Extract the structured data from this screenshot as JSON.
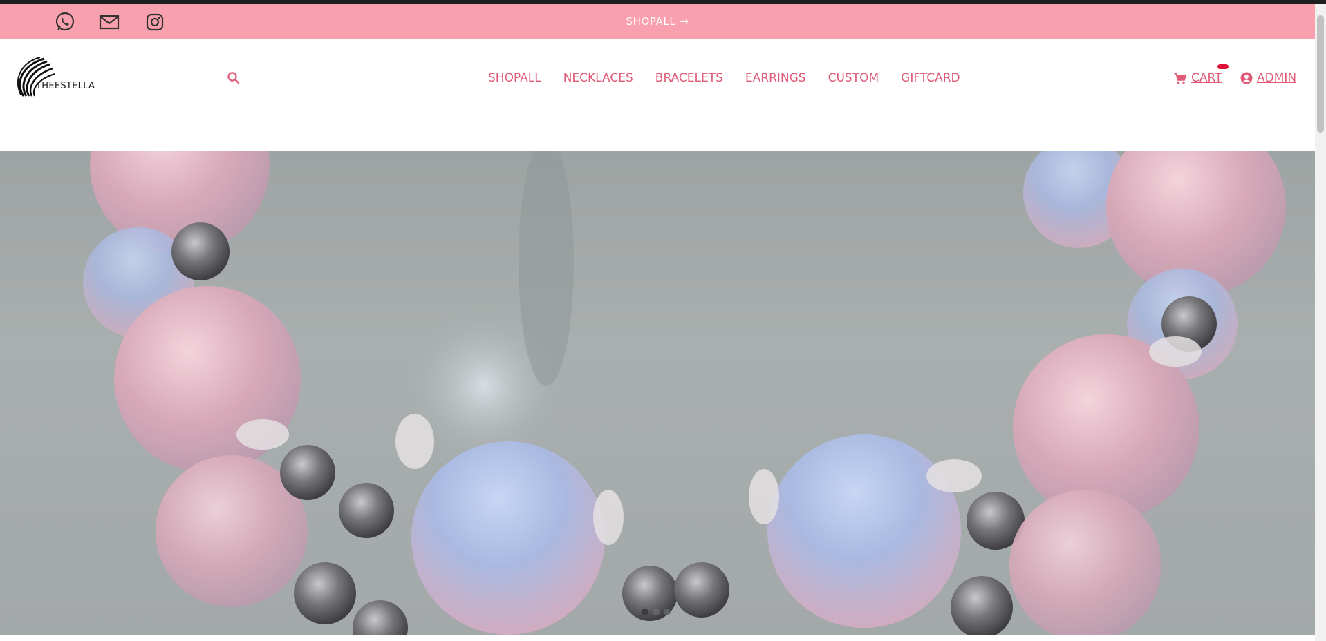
{
  "announcement": {
    "link_label": "SHOPALL",
    "arrow": "→",
    "background": "#f8a0ad"
  },
  "social_icons": [
    "whatsapp-icon",
    "mail-icon",
    "instagram-icon"
  ],
  "brand": {
    "name": "THEESTELLA"
  },
  "nav": {
    "items": [
      {
        "label": "SHOPALL"
      },
      {
        "label": "NECKLACES"
      },
      {
        "label": "BRACELETS"
      },
      {
        "label": "EARRINGS"
      },
      {
        "label": "CUSTOM"
      },
      {
        "label": "GIFTCARD"
      }
    ],
    "color": "#df5a76"
  },
  "account": {
    "cart_label": "CART",
    "admin_label": "ADMIN"
  },
  "hero": {
    "slide_count": 3,
    "active_slide": 1
  }
}
